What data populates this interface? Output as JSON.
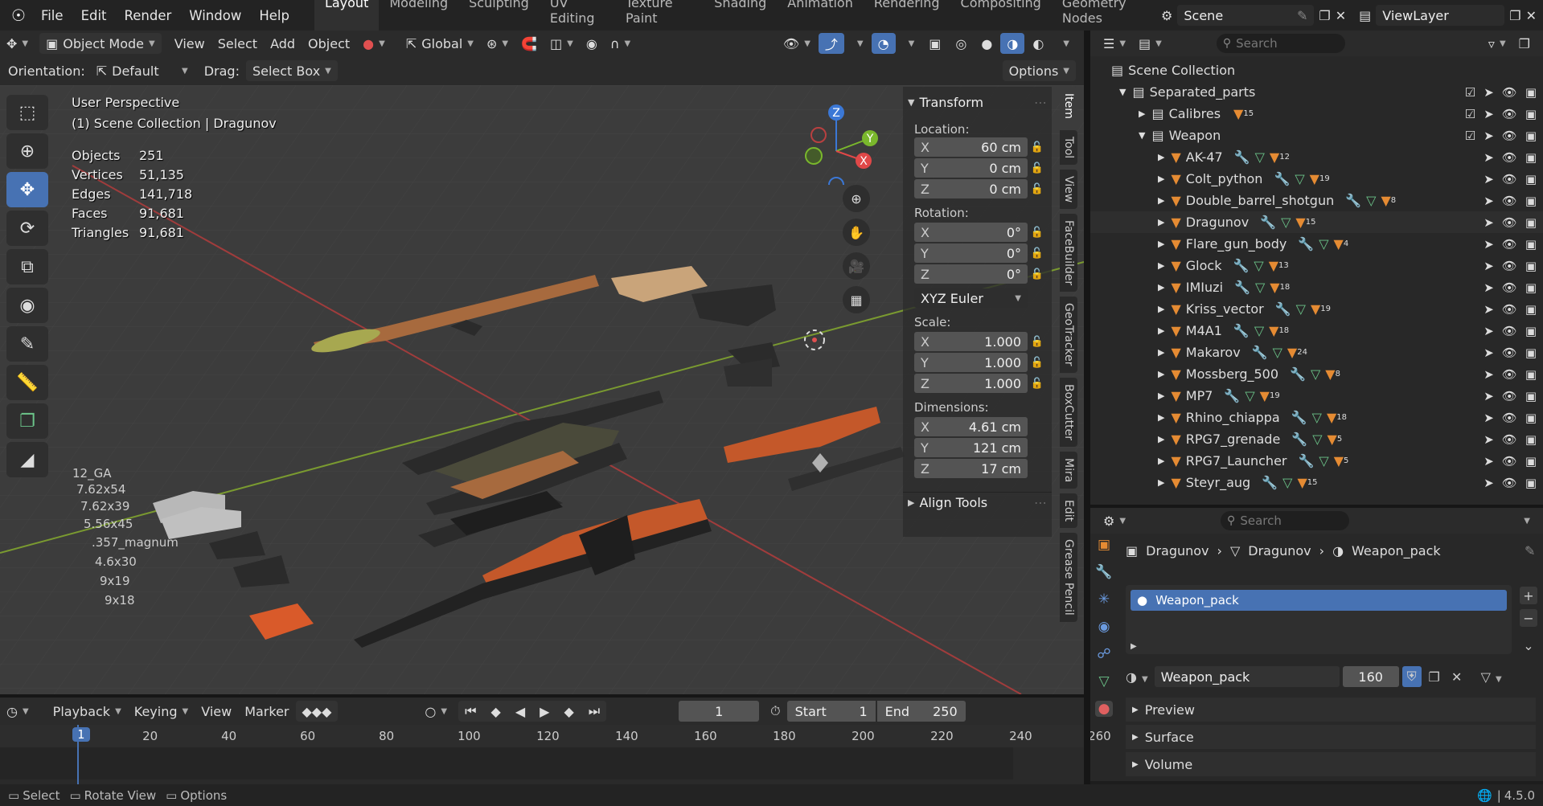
{
  "menu": {
    "items": [
      "File",
      "Edit",
      "Render",
      "Window",
      "Help"
    ]
  },
  "workspaces": [
    "Layout",
    "Modeling",
    "Sculpting",
    "UV Editing",
    "Texture Paint",
    "Shading",
    "Animation",
    "Rendering",
    "Compositing",
    "Geometry Nodes"
  ],
  "scene": {
    "name": "Scene",
    "view_layer": "ViewLayer"
  },
  "viewport_header": {
    "mode": "Object Mode",
    "view": "View",
    "select": "Select",
    "add": "Add",
    "object": "Object",
    "transform_orientation": "Global"
  },
  "tool_header": {
    "orientation_label": "Orientation:",
    "orientation_value": "Default",
    "drag_label": "Drag:",
    "drag_value": "Select Box",
    "options": "Options"
  },
  "overlay": {
    "perspective": "User Perspective",
    "collection": "(1) Scene Collection | Dragunov",
    "stats": [
      {
        "label": "Objects",
        "value": "251"
      },
      {
        "label": "Vertices",
        "value": "51,135"
      },
      {
        "label": "Edges",
        "value": "141,718"
      },
      {
        "label": "Faces",
        "value": "91,681"
      },
      {
        "label": "Triangles",
        "value": "91,681"
      }
    ]
  },
  "ammo_labels": [
    "12_GA",
    "7.62x54",
    "7.62x39",
    "5.56x45",
    ".357_magnum",
    "4.6x30",
    "9x19",
    "9x18"
  ],
  "gizmo": {
    "z": "Z",
    "y": "Y",
    "x": "X"
  },
  "n_panel": {
    "transform_title": "Transform",
    "location_label": "Location:",
    "location": [
      {
        "axis": "X",
        "value": "60 cm"
      },
      {
        "axis": "Y",
        "value": "0 cm"
      },
      {
        "axis": "Z",
        "value": "0 cm"
      }
    ],
    "rotation_label": "Rotation:",
    "rotation": [
      {
        "axis": "X",
        "value": "0°"
      },
      {
        "axis": "Y",
        "value": "0°"
      },
      {
        "axis": "Z",
        "value": "0°"
      }
    ],
    "rotation_mode": "XYZ Euler",
    "scale_label": "Scale:",
    "scale": [
      {
        "axis": "X",
        "value": "1.000"
      },
      {
        "axis": "Y",
        "value": "1.000"
      },
      {
        "axis": "Z",
        "value": "1.000"
      }
    ],
    "dimensions_label": "Dimensions:",
    "dimensions": [
      {
        "axis": "X",
        "value": "4.61 cm"
      },
      {
        "axis": "Y",
        "value": "121 cm"
      },
      {
        "axis": "Z",
        "value": "17 cm"
      }
    ],
    "align_tools": "Align Tools"
  },
  "side_tabs": [
    "Item",
    "Tool",
    "View",
    "FaceBuilder",
    "GeoTracker",
    "BoxCutter",
    "Mira",
    "Edit",
    "Grease Pencil"
  ],
  "outliner": {
    "search_placeholder": "Search",
    "root": "Scene Collection",
    "separated": "Separated_parts",
    "calibres": {
      "name": "Calibres",
      "count": "15"
    },
    "weapon": "Weapon",
    "items": [
      {
        "name": "AK-47",
        "count": "12"
      },
      {
        "name": "Colt_python",
        "count": "19"
      },
      {
        "name": "Double_barrel_shotgun",
        "count": "8"
      },
      {
        "name": "Dragunov",
        "count": "15"
      },
      {
        "name": "Flare_gun_body",
        "count": "4"
      },
      {
        "name": "Glock",
        "count": "13"
      },
      {
        "name": "IMIuzi",
        "count": "18"
      },
      {
        "name": "Kriss_vector",
        "count": "19"
      },
      {
        "name": "M4A1",
        "count": "18"
      },
      {
        "name": "Makarov",
        "count": "24"
      },
      {
        "name": "Mossberg_500",
        "count": "8"
      },
      {
        "name": "MP7",
        "count": "19"
      },
      {
        "name": "Rhino_chiappa",
        "count": "18"
      },
      {
        "name": "RPG7_grenade",
        "count": "5"
      },
      {
        "name": "RPG7_Launcher",
        "count": "5"
      },
      {
        "name": "Steyr_aug",
        "count": "15"
      }
    ]
  },
  "properties": {
    "search_placeholder": "Search",
    "breadcrumb": [
      "Dragunov",
      "Dragunov",
      "Weapon_pack"
    ],
    "material_slot": "Weapon_pack",
    "material_name": "Weapon_pack",
    "users": "160",
    "sections": [
      "Preview",
      "Surface",
      "Volume"
    ]
  },
  "timeline": {
    "playback": "Playback",
    "keying": "Keying",
    "view": "View",
    "marker": "Marker",
    "current_frame": "1",
    "start_label": "Start",
    "start": "1",
    "end_label": "End",
    "end": "250",
    "ruler": [
      "1",
      "20",
      "40",
      "60",
      "80",
      "100",
      "120",
      "140",
      "160",
      "180",
      "200",
      "220",
      "240",
      "260"
    ]
  },
  "status": {
    "select": "Select",
    "rotate": "Rotate View",
    "options": "Options",
    "version": "4.5.0"
  },
  "colors": {
    "accent": "#4772b3",
    "background": "#3c3c3c",
    "orange": "#e58b33",
    "green": "#6cc58a"
  }
}
